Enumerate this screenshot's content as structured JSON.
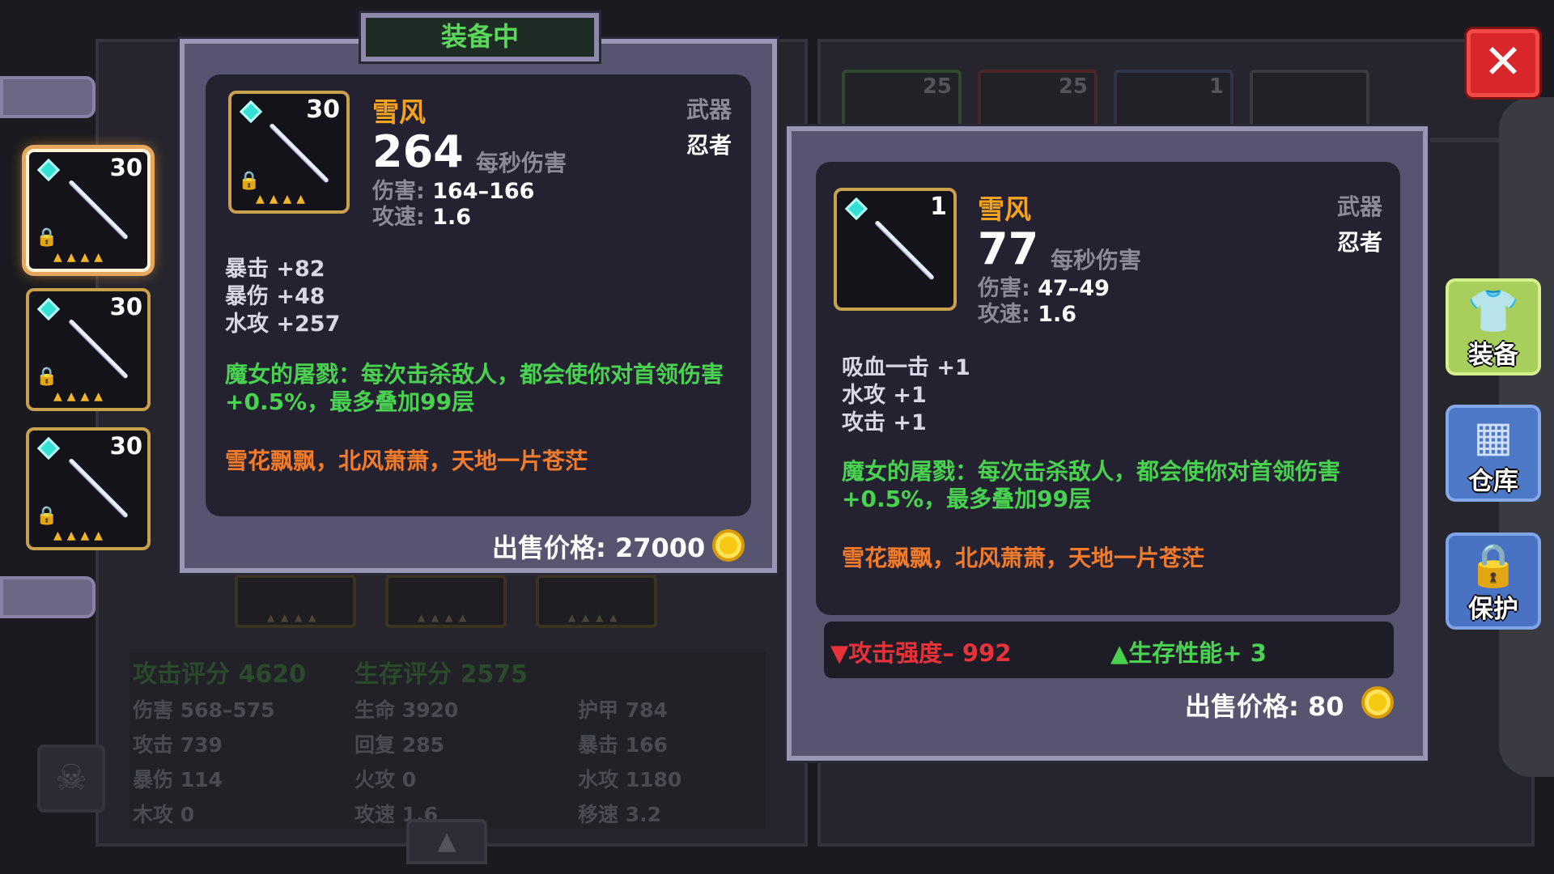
{
  "equipped_header": "装备中",
  "close_label": "✕",
  "equipped_item": {
    "name": "雪风",
    "level": "30",
    "dps": "264",
    "dps_label": "每秒伤害",
    "damage_key": "伤害: ",
    "damage_value": "164–166",
    "speed_key": "攻速: ",
    "speed_value": "1.6",
    "type": "武器",
    "class": "忍者",
    "attributes": [
      "暴击 +82",
      "暴伤 +48",
      "水攻 +257"
    ],
    "effect": "魔女的屠戮：每次击杀敌人，都会使你对首领伤害+0.5%，最多叠加99层",
    "flavor": "雪花飘飘，北风萧萧，天地一片苍茫",
    "price_text": "出售价格: 27000"
  },
  "new_item": {
    "name": "雪风",
    "level": "1",
    "dps": "77",
    "dps_label": "每秒伤害",
    "damage_key": "伤害: ",
    "damage_value": "47–49",
    "speed_key": "攻速: ",
    "speed_value": "1.6",
    "type": "武器",
    "class": "忍者",
    "attributes": [
      "吸血一击 +1",
      "水攻 +1",
      "攻击 +1"
    ],
    "effect": "魔女的屠戮：每次击杀敌人，都会使你对首领伤害+0.5%，最多叠加99层",
    "flavor": "雪花飘飘，北风萧萧，天地一片苍茫",
    "compare_down": "▼攻击强度– 992",
    "compare_up": "▲生存性能+ 3",
    "price_text": "出售价格: 80"
  },
  "item_list": {
    "levels": [
      "30",
      "30",
      "30"
    ]
  },
  "background_slots": [
    {
      "num": "25"
    },
    {
      "num": "25"
    },
    {
      "num": "1"
    }
  ],
  "stats": {
    "attack_score": "攻击评分 4620",
    "survival_score": "生存评分 2575",
    "cells": [
      "伤害 568–575",
      "生命 3920",
      "护甲 784",
      "攻击 739",
      "回复 285",
      "暴击 166",
      "暴伤 114",
      "火攻 0",
      "水攻 1180",
      "木攻 0",
      "攻速 1.6",
      "移速 3.2"
    ]
  },
  "sidebar": {
    "equip_label": "装备",
    "storage_label": "仓库",
    "protect_label": "保护"
  },
  "colors": {
    "gold_text": "#f3a320",
    "green_effect": "#48d250",
    "orange_flavor": "#f27c2c",
    "red_down": "#e8323a",
    "panel_border": "#9a96b6",
    "close_red": "#d8262a"
  }
}
